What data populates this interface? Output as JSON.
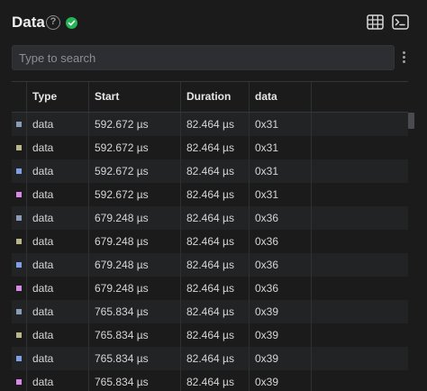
{
  "header": {
    "title": "Data",
    "help_glyph": "?"
  },
  "search": {
    "placeholder": "Type to search"
  },
  "table": {
    "columns": [
      "Type",
      "Start",
      "Duration",
      "data"
    ],
    "rows": [
      {
        "type": "data",
        "start": "592.672 µs",
        "duration": "82.464 µs",
        "data": "0x31",
        "color": "#8a9bb8"
      },
      {
        "type": "data",
        "start": "592.672 µs",
        "duration": "82.464 µs",
        "data": "0x31",
        "color": "#bdb58a"
      },
      {
        "type": "data",
        "start": "592.672 µs",
        "duration": "82.464 µs",
        "data": "0x31",
        "color": "#7f9ee8"
      },
      {
        "type": "data",
        "start": "592.672 µs",
        "duration": "82.464 µs",
        "data": "0x31",
        "color": "#d889e8"
      },
      {
        "type": "data",
        "start": "679.248 µs",
        "duration": "82.464 µs",
        "data": "0x36",
        "color": "#8a9bb8"
      },
      {
        "type": "data",
        "start": "679.248 µs",
        "duration": "82.464 µs",
        "data": "0x36",
        "color": "#bdb58a"
      },
      {
        "type": "data",
        "start": "679.248 µs",
        "duration": "82.464 µs",
        "data": "0x36",
        "color": "#7f9ee8"
      },
      {
        "type": "data",
        "start": "679.248 µs",
        "duration": "82.464 µs",
        "data": "0x36",
        "color": "#d889e8"
      },
      {
        "type": "data",
        "start": "765.834 µs",
        "duration": "82.464 µs",
        "data": "0x39",
        "color": "#8a9bb8"
      },
      {
        "type": "data",
        "start": "765.834 µs",
        "duration": "82.464 µs",
        "data": "0x39",
        "color": "#bdb58a"
      },
      {
        "type": "data",
        "start": "765.834 µs",
        "duration": "82.464 µs",
        "data": "0x39",
        "color": "#7f9ee8"
      },
      {
        "type": "data",
        "start": "765.834 µs",
        "duration": "82.464 µs",
        "data": "0x39",
        "color": "#d889e8"
      }
    ]
  },
  "icons": {
    "help": "help-circle-icon",
    "status": "check-circle-icon",
    "table_view": "table-grid-icon",
    "terminal": "terminal-icon",
    "menu": "more-vertical-icon"
  }
}
